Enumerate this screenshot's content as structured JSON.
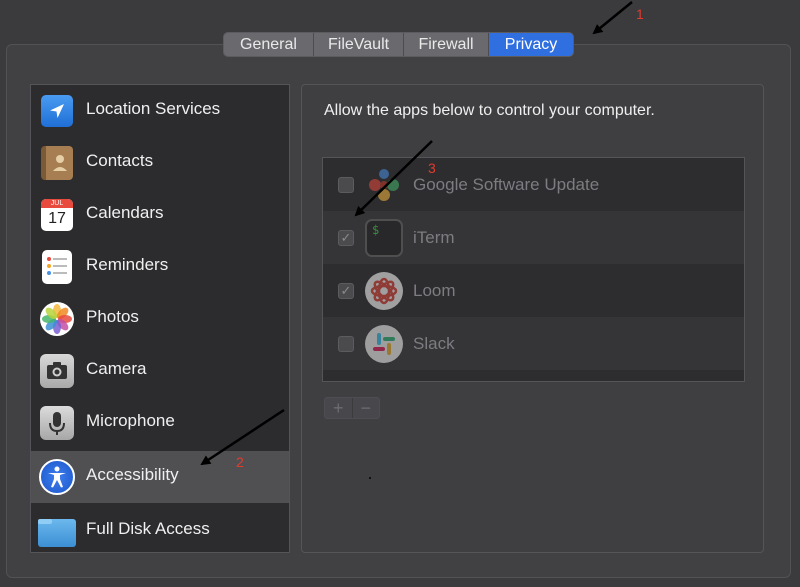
{
  "tabs": [
    {
      "label": "General",
      "active": false
    },
    {
      "label": "FileVault",
      "active": false
    },
    {
      "label": "Firewall",
      "active": false
    },
    {
      "label": "Privacy",
      "active": true
    }
  ],
  "sidebar": {
    "items": [
      {
        "label": "Location Services",
        "icon": "location-arrow-icon",
        "selected": false
      },
      {
        "label": "Contacts",
        "icon": "contacts-book-icon",
        "selected": false
      },
      {
        "label": "Calendars",
        "icon": "calendar-icon",
        "selected": false,
        "icon_month": "JUL",
        "icon_day": "17"
      },
      {
        "label": "Reminders",
        "icon": "reminders-list-icon",
        "selected": false
      },
      {
        "label": "Photos",
        "icon": "photos-flower-icon",
        "selected": false
      },
      {
        "label": "Camera",
        "icon": "camera-icon",
        "selected": false
      },
      {
        "label": "Microphone",
        "icon": "microphone-icon",
        "selected": false
      },
      {
        "label": "Accessibility",
        "icon": "accessibility-icon",
        "selected": true
      },
      {
        "label": "Full Disk Access",
        "icon": "folder-icon",
        "selected": false
      }
    ]
  },
  "detail": {
    "heading": "Allow the apps below to control your computer.",
    "apps": [
      {
        "name": "Google Software Update",
        "checked": false,
        "icon": "google-software-update-icon"
      },
      {
        "name": "iTerm",
        "checked": true,
        "icon": "iterm-icon",
        "icon_text": "$"
      },
      {
        "name": "Loom",
        "checked": true,
        "icon": "loom-icon"
      },
      {
        "name": "Slack",
        "checked": false,
        "icon": "slack-icon"
      }
    ],
    "add_label": "+",
    "remove_label": "−"
  },
  "annotations": {
    "n1": "1",
    "n2": "2",
    "n3": "3",
    "color": "#e23b2e"
  },
  "colors": {
    "accent": "#2f6fe0",
    "background": "#3b3a3d"
  }
}
